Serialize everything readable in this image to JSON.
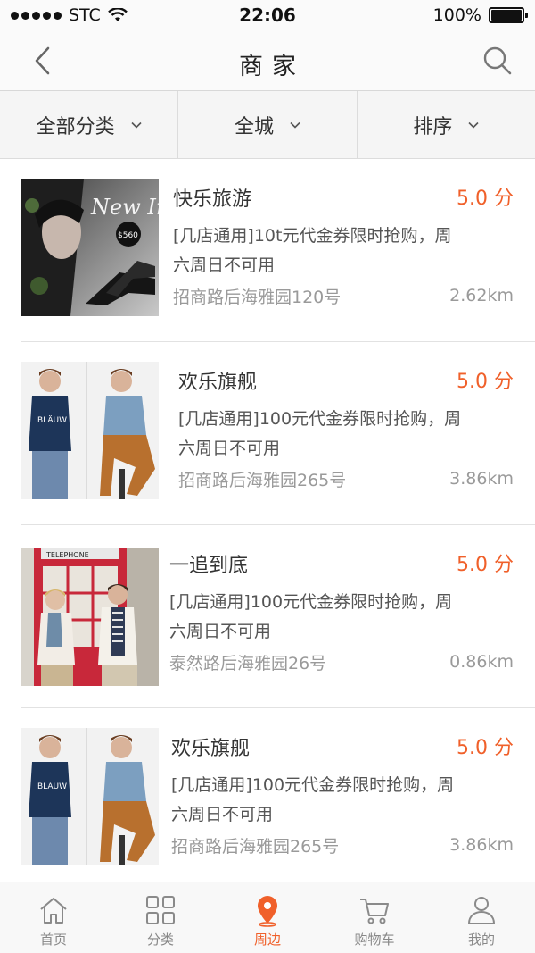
{
  "status_bar": {
    "carrier": "STC",
    "time": "22:06",
    "battery_text": "100%",
    "battery_level": 1.0,
    "signal_bars": 5
  },
  "nav": {
    "title": "商家"
  },
  "filters": [
    {
      "label": "全部分类"
    },
    {
      "label": "全城"
    },
    {
      "label": "排序"
    }
  ],
  "listings": [
    {
      "name": "快乐旅游",
      "score": "5.0 分",
      "desc_line1": "[几店通用]10t元代金券限时抢购，周",
      "desc_line2": "六周日不可用",
      "address": "招商路后海雅园120号",
      "distance": "2.62km",
      "thumb_icon": "fashion-shoes-photo"
    },
    {
      "name": "欢乐旗舰",
      "score": "5.0 分",
      "desc_line1": "[几店通用]100元代金券限时抢购，周",
      "desc_line2": "六周日不可用",
      "address": "招商路后海雅园265号",
      "distance": "3.86km",
      "thumb_icon": "men-apparel-photo"
    },
    {
      "name": "一追到底",
      "score": "5.0 分",
      "desc_line1": "[几店通用]100元代金券限时抢购，周",
      "desc_line2": "六周日不可用",
      "address": "泰然路后海雅园26号",
      "distance": "0.86km",
      "thumb_icon": "telephone-booth-photo",
      "thumb_text": "TELEPHONE"
    },
    {
      "name": "欢乐旗舰",
      "score": "5.0 分",
      "desc_line1": "[几店通用]100元代金券限时抢购，周",
      "desc_line2": "六周日不可用",
      "address": "招商路后海雅园265号",
      "distance": "3.86km",
      "thumb_icon": "men-apparel-photo"
    }
  ],
  "tabs": [
    {
      "label": "首页",
      "icon": "home-icon"
    },
    {
      "label": "分类",
      "icon": "grid-icon"
    },
    {
      "label": "周边",
      "icon": "location-pin-icon",
      "active": true
    },
    {
      "label": "购物车",
      "icon": "cart-icon"
    },
    {
      "label": "我的",
      "icon": "user-icon"
    }
  ],
  "colors": {
    "accent": "#f0602a",
    "text_primary": "#333333",
    "text_secondary": "#9a9a9a"
  }
}
